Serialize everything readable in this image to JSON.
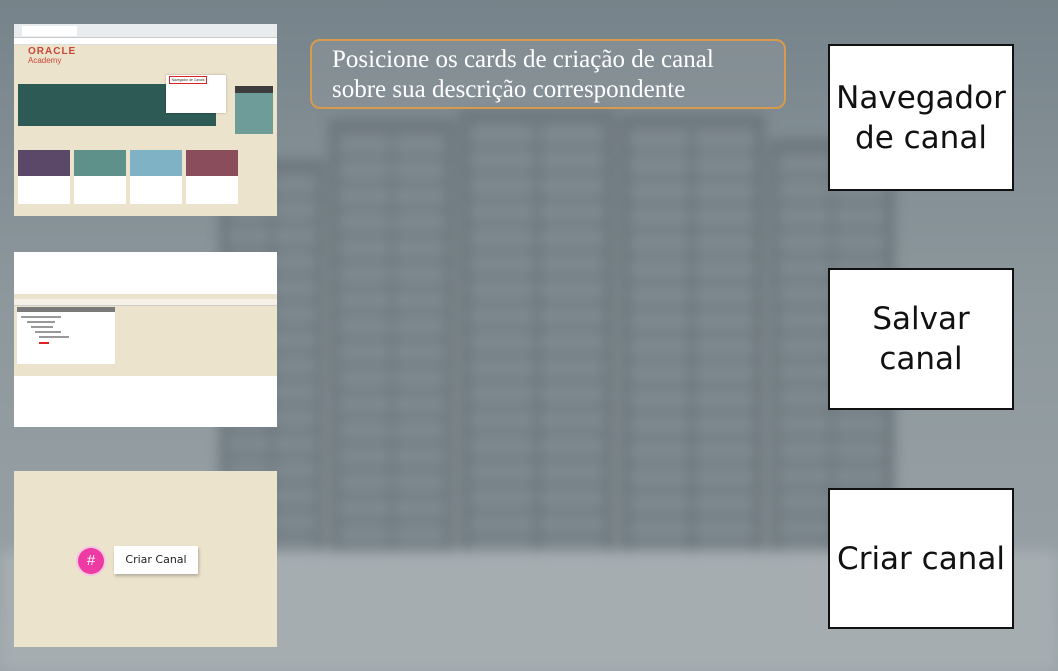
{
  "instruction": {
    "line1": "Posicione os cards de criação de canal",
    "line2": "sobre sua descrição correspondente"
  },
  "targets": [
    {
      "label": "Navegador\nde canal"
    },
    {
      "label": "Salvar canal"
    },
    {
      "label": "Criar canal"
    }
  ],
  "cards": {
    "browser_card": {
      "logo_line1": "ORACLE",
      "logo_line2": "Academy",
      "dropdown_item": "Navegador de Canais",
      "tile_colors": [
        "#5b4868",
        "#5f918b",
        "#7fb2c5",
        "#8a4d5c"
      ]
    },
    "save_card": {},
    "create_card": {
      "hash_symbol": "#",
      "button_label": "Criar Canal"
    }
  }
}
